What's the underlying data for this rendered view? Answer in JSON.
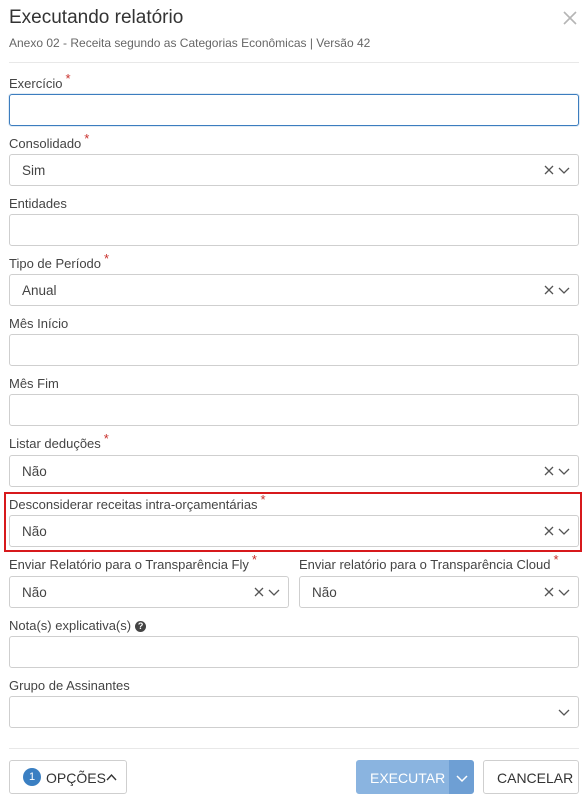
{
  "dialog": {
    "title": "Executando relatório",
    "subtitle": "Anexo 02 - Receita segundo as Categorias Econômicas | Versão 42"
  },
  "fields": {
    "exercicio": {
      "label": "Exercício",
      "required": "*",
      "value": ""
    },
    "consolidado": {
      "label": "Consolidado",
      "required": "*",
      "value": "Sim"
    },
    "entidades": {
      "label": "Entidades",
      "value": ""
    },
    "tipo_periodo": {
      "label": "Tipo de Período",
      "required": "*",
      "value": "Anual"
    },
    "mes_inicio": {
      "label": "Mês Início",
      "value": ""
    },
    "mes_fim": {
      "label": "Mês Fim",
      "value": ""
    },
    "listar_deducoes": {
      "label": "Listar deduções",
      "required": "*",
      "value": "Não"
    },
    "desconsiderar": {
      "label": "Desconsiderar receitas intra-orçamentárias",
      "required": "*",
      "value": "Não"
    },
    "transparencia_fly": {
      "label": "Enviar Relatório para o Transparência Fly",
      "required": "*",
      "value": "Não"
    },
    "transparencia_cloud": {
      "label": "Enviar relatório para o Transparência Cloud",
      "required": "*",
      "value": "Não"
    },
    "notas": {
      "label": "Nota(s) explicativa(s)",
      "help_icon": "?",
      "value": ""
    },
    "grupo_assinantes": {
      "label": "Grupo de Assinantes",
      "value": ""
    }
  },
  "footer": {
    "options_count": "1",
    "options_label": "OPÇÕES",
    "execute_label": "EXECUTAR",
    "cancel_label": "CANCELAR"
  },
  "colors": {
    "required": "#c9302c",
    "highlight_border": "#d7191c",
    "primary": "#8ab4e0",
    "badge": "#3a7fc2",
    "focus_border": "#3c7dbf"
  },
  "icons": {
    "close": "close-icon",
    "clear": "clear-x-icon",
    "dropdown": "chevron-down-icon",
    "help": "question-circle-icon",
    "options_toggle": "chevron-up-icon"
  }
}
